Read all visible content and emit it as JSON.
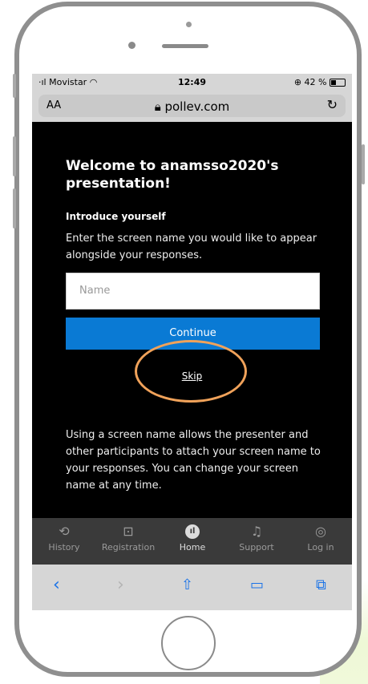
{
  "status": {
    "carrier": "Movistar",
    "time": "12:49",
    "battery": "42 %"
  },
  "browser": {
    "aa": "AA",
    "url": "pollev.com"
  },
  "page": {
    "title": "Welcome to anamsso2020's presentation!",
    "section_heading": "Introduce yourself",
    "instruction": "Enter the screen name you would like to appear alongside your responses.",
    "name_placeholder": "Name",
    "continue_label": "Continue",
    "skip_label": "Skip",
    "info": "Using a screen name allows the presenter and other participants to attach your screen name to your responses. You can change your screen name at any time."
  },
  "tabs": [
    {
      "label": "History",
      "icon": "history-icon"
    },
    {
      "label": "Registration",
      "icon": "registration-icon"
    },
    {
      "label": "Home",
      "icon": "home-icon"
    },
    {
      "label": "Support",
      "icon": "support-icon"
    },
    {
      "label": "Log in",
      "icon": "login-icon"
    }
  ],
  "colors": {
    "accent": "#0a7ad4",
    "highlight_circle": "#f0a25a"
  }
}
